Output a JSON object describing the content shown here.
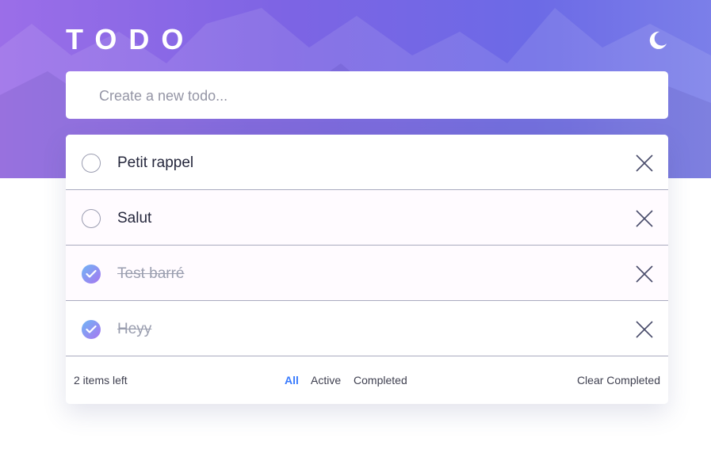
{
  "app": {
    "title": "TODO"
  },
  "new_todo": {
    "placeholder": "Create a new todo...",
    "value": ""
  },
  "todos": [
    {
      "text": "Petit rappel",
      "completed": false
    },
    {
      "text": "Salut",
      "completed": false
    },
    {
      "text": "Test barré",
      "completed": true
    },
    {
      "text": "Heyy",
      "completed": true
    }
  ],
  "footer": {
    "items_left": "2 items left",
    "filters": [
      "All",
      "Active",
      "Completed"
    ],
    "active_filter": "All",
    "clear_label": "Clear Completed"
  },
  "icons": {
    "theme_toggle": "moon-icon",
    "check": "check-icon",
    "delete": "close-icon"
  },
  "colors": {
    "accent": "#3a7bfd",
    "hero_gradient_start": "#9b6ee8",
    "hero_gradient_end": "#7b7fe9",
    "check_gradient_start": "#6fb6f5",
    "check_gradient_end": "#a875f0"
  }
}
